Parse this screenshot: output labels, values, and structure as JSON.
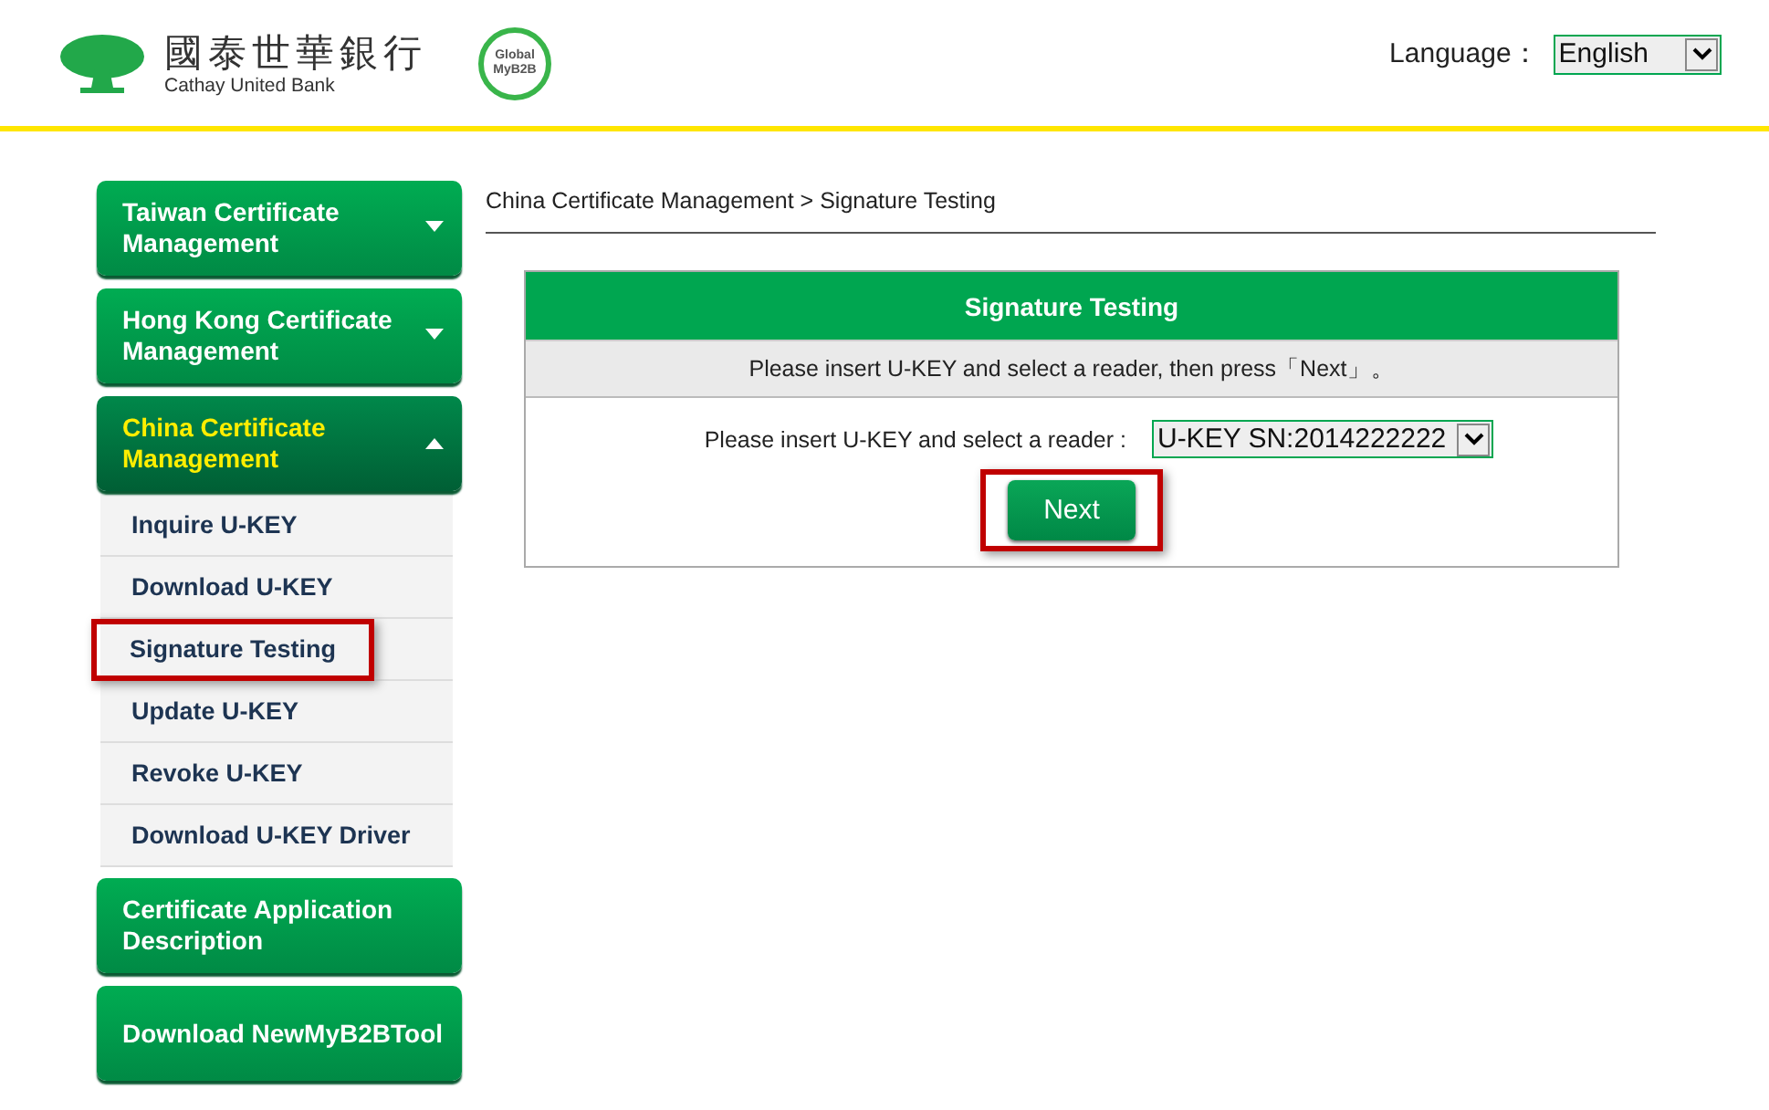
{
  "header": {
    "brand_name": "國泰世華銀行",
    "brand_subtitle": "Cathay United Bank",
    "badge_lines": [
      "Global",
      "MyB2B"
    ],
    "language_label": "Language：",
    "language_value": "English"
  },
  "sidebar": {
    "groups": [
      {
        "label": "Taiwan Certificate Management",
        "kind": "menu",
        "expanded": false
      },
      {
        "label": "Hong Kong Certificate Management",
        "kind": "menu",
        "expanded": false
      },
      {
        "label": "China Certificate Management",
        "kind": "menu",
        "expanded": true,
        "children": [
          {
            "label": "Inquire U-KEY",
            "highlighted": false
          },
          {
            "label": "Download U-KEY",
            "highlighted": false
          },
          {
            "label": "Signature Testing",
            "highlighted": true
          },
          {
            "label": "Update U-KEY",
            "highlighted": false
          },
          {
            "label": "Revoke U-KEY",
            "highlighted": false
          },
          {
            "label": "Download U-KEY Driver",
            "highlighted": false
          }
        ]
      },
      {
        "label": "Certificate Application Description",
        "kind": "link"
      },
      {
        "label": "Download NewMyB2BTool",
        "kind": "link"
      }
    ]
  },
  "breadcrumb": "China Certificate Management > Signature Testing",
  "panel": {
    "title": "Signature Testing",
    "instruction": "Please insert U-KEY and select a reader, then press「Next」。",
    "reader_label": "Please insert U-KEY and select a reader :",
    "reader_value": "U-KEY SN:2014222222",
    "next_button": {
      "label": "Next",
      "highlighted": true
    }
  }
}
